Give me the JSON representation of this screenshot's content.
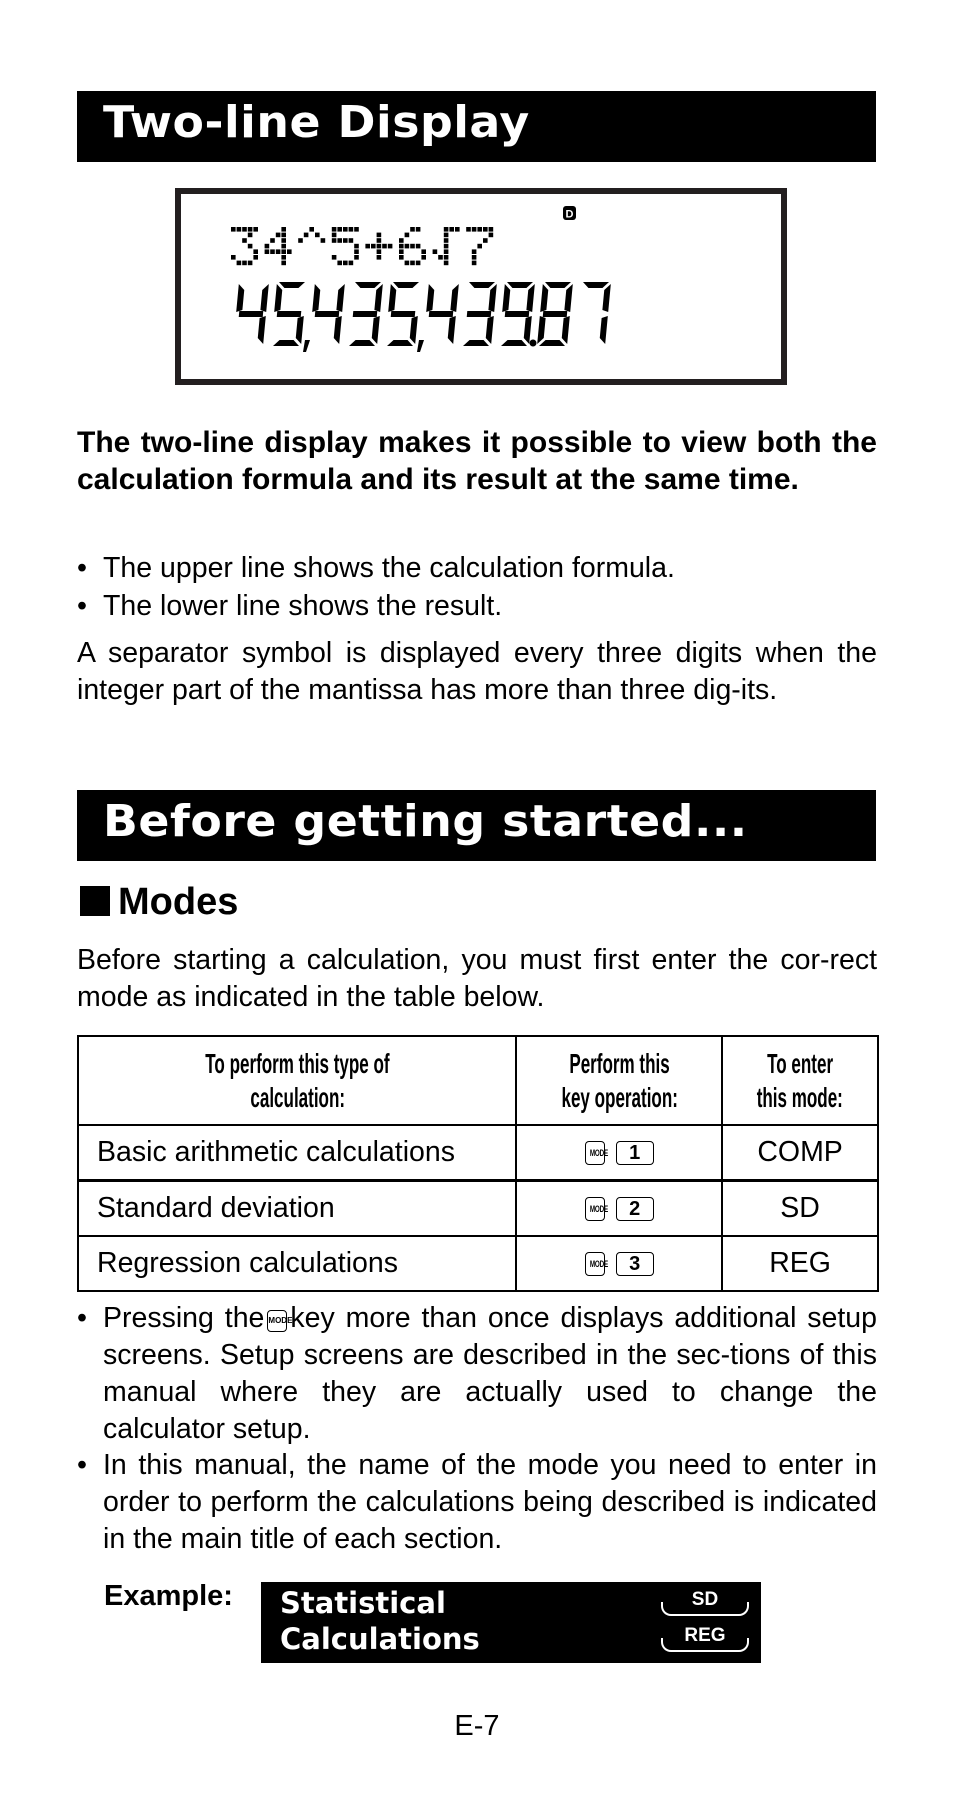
{
  "sections": [
    {
      "title": "Two-line Display"
    },
    {
      "title": "Before getting started..."
    }
  ],
  "lcd": {
    "indicator": "D",
    "formula": "34^5+6√7",
    "result": "45,435,439.87"
  },
  "two_line": {
    "intro": "The two-line display makes it possible to view both the calculation formula and its result at the same time.",
    "bullets": [
      "The upper line shows the calculation formula.",
      "The lower line shows the result."
    ],
    "separator_note": "A separator symbol is displayed every three digits when the integer part of the mantissa has more than three dig-its."
  },
  "modes": {
    "heading": "Modes",
    "intro": "Before starting a calculation, you must first enter the cor-rect mode as indicated in the table below.",
    "table": {
      "headers": [
        "To perform this type of calculation:",
        "Perform this key operation:",
        "To enter this mode:"
      ],
      "header_lines": [
        [
          "To perform this type of",
          "calculation:"
        ],
        [
          "Perform this",
          "key operation:"
        ],
        [
          "To enter",
          "this mode:"
        ]
      ],
      "rows": [
        {
          "calculation": "Basic arithmetic calculations",
          "keys": [
            "MODE",
            "1"
          ],
          "mode": "COMP"
        },
        {
          "calculation": "Standard deviation",
          "keys": [
            "MODE",
            "2"
          ],
          "mode": "SD"
        },
        {
          "calculation": "Regression calculations",
          "keys": [
            "MODE",
            "3"
          ],
          "mode": "REG"
        }
      ]
    },
    "notes": [
      {
        "before": "Pressing the",
        "key": "MODE",
        "after": "key more than once displays additional setup screens. Setup screens are described in the sec-tions of this manual where they are actually used to change the calculator setup."
      },
      {
        "text": "In this manual, the name of the mode you need to enter in order to perform the calculations being described is indicated in the main title of each section."
      }
    ],
    "example": {
      "label": "Example:",
      "title_lines": [
        "Statistical",
        "Calculations"
      ],
      "mode_tags": [
        "SD",
        "REG"
      ]
    }
  },
  "bullet_glyph": "•",
  "page_number": "E-7"
}
